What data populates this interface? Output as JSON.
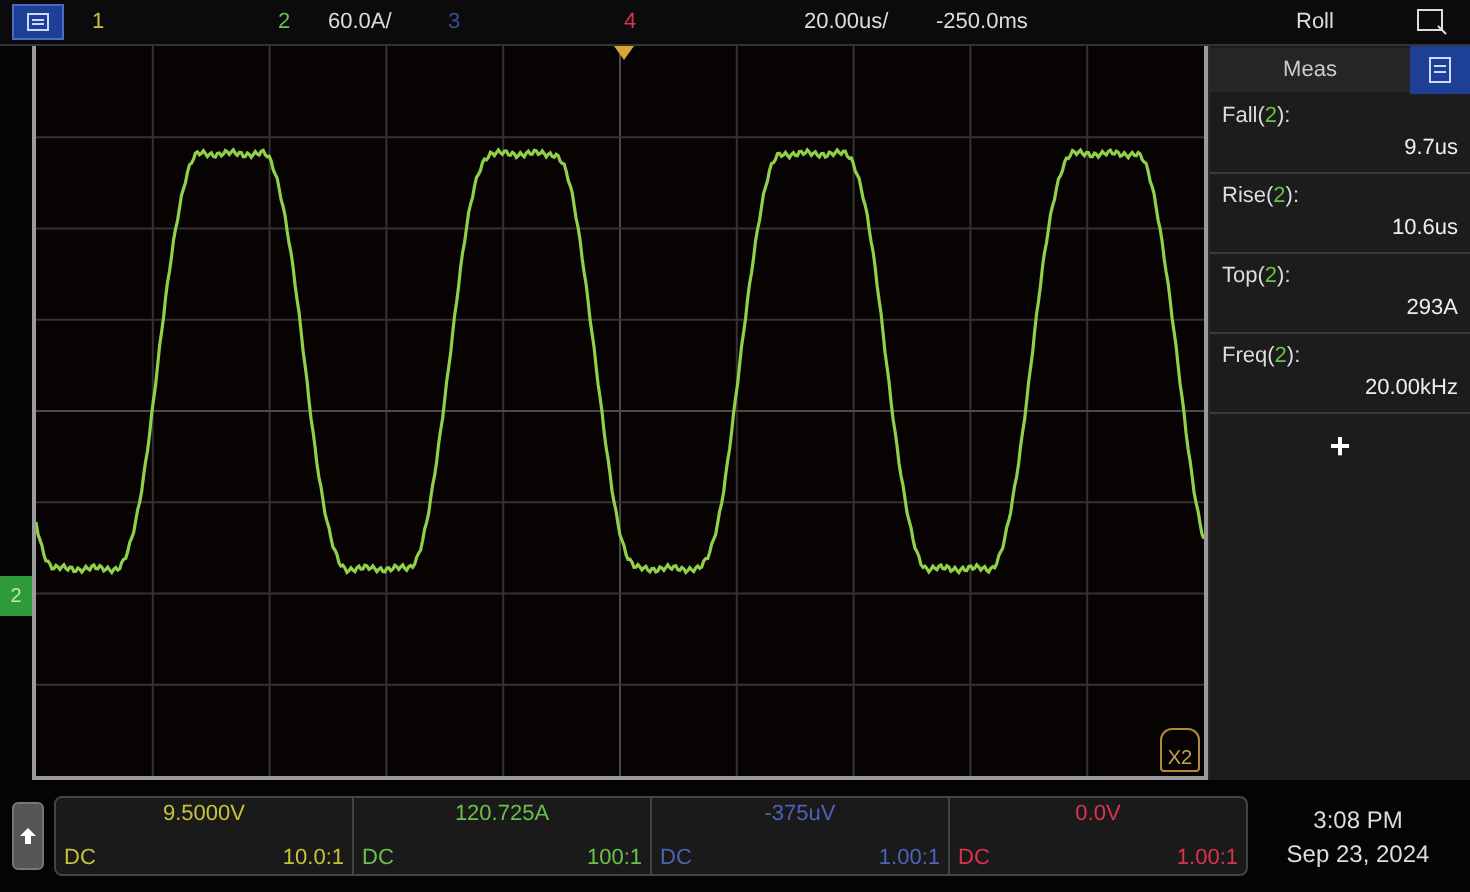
{
  "top_bar": {
    "channels": [
      {
        "label": "1",
        "color": "#c8c23a"
      },
      {
        "label": "2",
        "color": "#6cc04a",
        "scale": "60.0A/"
      },
      {
        "label": "3",
        "color": "#3d4f9a"
      },
      {
        "label": "4",
        "color": "#d8344f"
      }
    ],
    "timebase": "20.00us/",
    "delay": "-250.0ms",
    "mode": "Roll"
  },
  "graticule": {
    "ground_marker": "2",
    "expansion_marker": "X2"
  },
  "meas_panel": {
    "title": "Meas",
    "items": [
      {
        "label_before": "Fall(",
        "channel": "2",
        "label_after": "):",
        "value": "9.7us"
      },
      {
        "label_before": "Rise(",
        "channel": "2",
        "label_after": "):",
        "value": "10.6us"
      },
      {
        "label_before": "Top(",
        "channel": "2",
        "label_after": "):",
        "value": "293A"
      },
      {
        "label_before": "Freq(",
        "channel": "2",
        "label_after": "):",
        "value": "20.00kHz"
      }
    ],
    "add": "+"
  },
  "bottom_bar": {
    "channels": [
      {
        "reading": "9.5000V",
        "coupling": "DC",
        "probe": "10.0:1",
        "color": "#c8c23a"
      },
      {
        "reading": "120.725A",
        "coupling": "DC",
        "probe": "100:1",
        "color": "#6cc04a"
      },
      {
        "reading": "-375uV",
        "coupling": "DC",
        "probe": "1.00:1",
        "color": "#4d63b8"
      },
      {
        "reading": "0.0V",
        "coupling": "DC",
        "probe": "1.00:1",
        "color": "#d8344f"
      }
    ],
    "time": "3:08 PM",
    "date": "Sep 23, 2024"
  }
}
